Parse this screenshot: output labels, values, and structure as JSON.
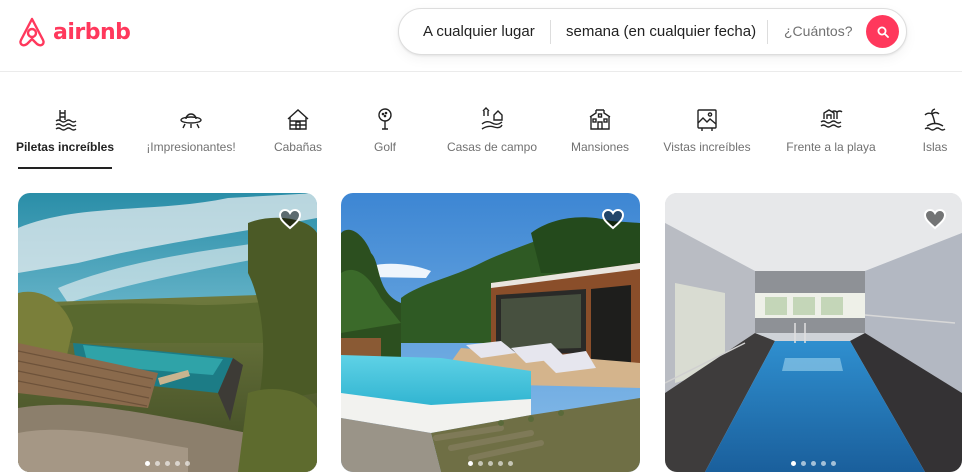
{
  "brand": {
    "name": "airbnb",
    "color": "#ff385c"
  },
  "search": {
    "where": "A cualquier lugar",
    "when": "semana (en cualquier fecha)",
    "guests": "¿Cuántos?",
    "button_icon": "search-icon"
  },
  "categories": [
    {
      "label": "Piletas increíbles",
      "icon": "pool-icon",
      "active": true
    },
    {
      "label": "¡Impresionantes!",
      "icon": "ufo-icon",
      "active": false
    },
    {
      "label": "Cabañas",
      "icon": "cabin-icon",
      "active": false
    },
    {
      "label": "Golf",
      "icon": "golf-icon",
      "active": false
    },
    {
      "label": "Casas de campo",
      "icon": "countryside-icon",
      "active": false
    },
    {
      "label": "Mansiones",
      "icon": "mansion-icon",
      "active": false
    },
    {
      "label": "Vistas increíbles",
      "icon": "views-icon",
      "active": false
    },
    {
      "label": "Frente a la playa",
      "icon": "beachfront-icon",
      "active": false
    },
    {
      "label": "Islas",
      "icon": "island-icon",
      "active": false
    }
  ],
  "listings": [
    {
      "image": "infinity-pool-hillside-photo",
      "favorite_icon": "heart-icon",
      "photo_count": 5,
      "current_photo": 1
    },
    {
      "image": "pool-wooden-house-photo",
      "favorite_icon": "heart-icon",
      "photo_count": 5,
      "current_photo": 1
    },
    {
      "image": "indoor-pool-photo",
      "favorite_icon": "heart-icon",
      "photo_count": 5,
      "current_photo": 1
    }
  ]
}
